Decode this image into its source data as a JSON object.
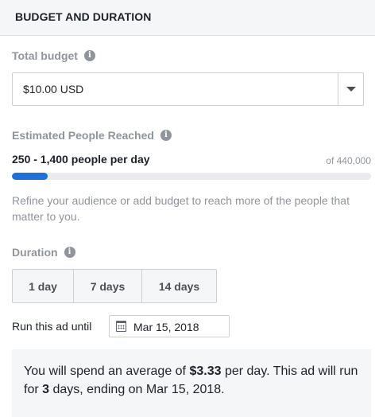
{
  "section": {
    "title": "BUDGET AND DURATION"
  },
  "budget": {
    "label": "Total budget",
    "value": "$10.00 USD"
  },
  "reach": {
    "label": "Estimated People Reached",
    "range": "250 - 1,400 people per day",
    "total": "of 440,000",
    "progress_fraction": 0.1,
    "note": "Refine your audience or add budget to reach more of the people that matter to you."
  },
  "duration": {
    "label": "Duration",
    "options": [
      "1 day",
      "7 days",
      "14 days"
    ]
  },
  "run_until": {
    "label": "Run this ad until",
    "date": "Mar 15, 2018"
  },
  "summary": {
    "part1": "You will spend an average of ",
    "amount": "$3.33",
    "part2": " per day. This ad will run for ",
    "days": "3",
    "part3": " days, ending on Mar 15, 2018."
  },
  "icons": {
    "info": "info-icon",
    "dropdown": "chevron-down-icon",
    "calendar": "calendar-icon"
  },
  "colors": {
    "accent": "#1e6fd9",
    "muted_text": "#90949c",
    "panel_bg": "#f5f6f7"
  }
}
